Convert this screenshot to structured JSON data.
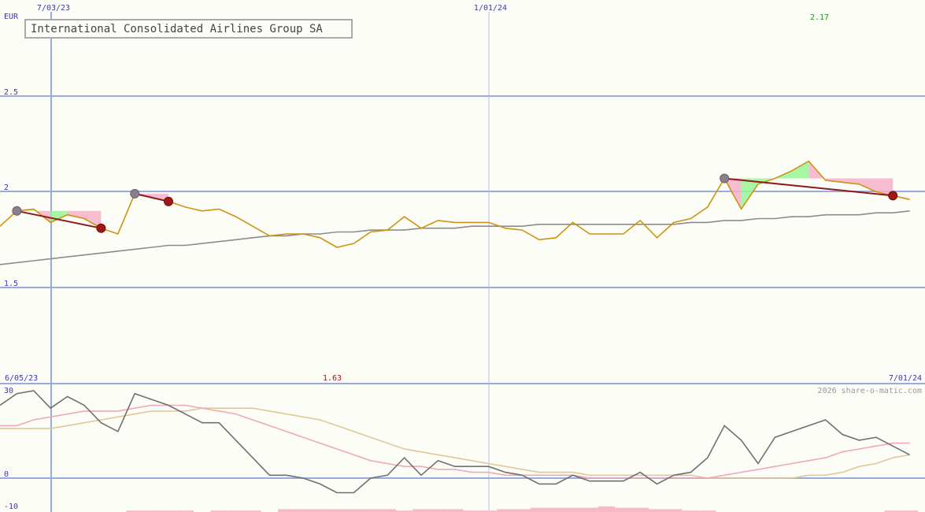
{
  "chart_data": [
    {
      "type": "line",
      "title": "International Consolidated Airlines Group SA",
      "ylabel": "EUR",
      "ylim": [
        1.5,
        2.5
      ],
      "y_ticks": [
        {
          "value": 2.5,
          "label": "2.5"
        },
        {
          "value": 2.0,
          "label": "2"
        },
        {
          "value": 1.5,
          "label": "1.5"
        }
      ],
      "x_ticks": [
        {
          "i": 3,
          "label": "7/03/23"
        },
        {
          "i": 29,
          "label": "1/01/24"
        }
      ],
      "start_date_label": "6/05/23",
      "end_date_label": "7/01/24",
      "high_label": "2.17",
      "low_label": "1.63",
      "grid": true,
      "colors": {
        "price": "#cc9411",
        "ma": "#8c8c8c",
        "trend": "#8b1a1a",
        "grid": "#99aadd",
        "up_fill": "#98f598",
        "down_fill": "#f5b0c8"
      },
      "series": [
        {
          "key": "price",
          "values": [
            1.82,
            1.9,
            1.91,
            1.84,
            1.88,
            1.86,
            1.81,
            1.78,
            1.99,
            1.97,
            1.95,
            1.92,
            1.9,
            1.91,
            1.87,
            1.82,
            1.77,
            1.78,
            1.78,
            1.76,
            1.71,
            1.73,
            1.79,
            1.8,
            1.87,
            1.81,
            1.85,
            1.84,
            1.84,
            1.84,
            1.81,
            1.8,
            1.75,
            1.76,
            1.84,
            1.78,
            1.78,
            1.78,
            1.85,
            1.76,
            1.84,
            1.86,
            1.92,
            2.07,
            1.91,
            2.04,
            2.07,
            2.11,
            2.16,
            2.06,
            2.05,
            2.04,
            2.0,
            1.98,
            1.96
          ]
        },
        {
          "key": "ma",
          "values": [
            1.62,
            1.63,
            1.64,
            1.65,
            1.66,
            1.67,
            1.68,
            1.69,
            1.7,
            1.71,
            1.72,
            1.72,
            1.73,
            1.74,
            1.75,
            1.76,
            1.77,
            1.77,
            1.78,
            1.78,
            1.79,
            1.79,
            1.8,
            1.8,
            1.8,
            1.81,
            1.81,
            1.81,
            1.82,
            1.82,
            1.82,
            1.82,
            1.83,
            1.83,
            1.83,
            1.83,
            1.83,
            1.83,
            1.83,
            1.83,
            1.83,
            1.84,
            1.84,
            1.85,
            1.85,
            1.86,
            1.86,
            1.87,
            1.87,
            1.88,
            1.88,
            1.88,
            1.89,
            1.89,
            1.9
          ]
        }
      ],
      "trend_segments": [
        {
          "i1": 1,
          "i2": 6
        },
        {
          "i1": 8,
          "i2": 10
        },
        {
          "i1": 43,
          "i2": 53
        }
      ]
    },
    {
      "type": "line",
      "ylim": [
        -10,
        30
      ],
      "y_ticks": [
        {
          "value": 30,
          "label": "30"
        },
        {
          "value": 0,
          "label": "0"
        },
        {
          "value": -10,
          "label": "-10"
        }
      ],
      "watermark": "2026 share-o-matic.com",
      "grid": true,
      "colors": {
        "line1": "#707070",
        "line2": "#f0a8b8",
        "line3": "#e0c898",
        "bars": "#f8b8c8"
      },
      "series": [
        {
          "key": "line1",
          "values": [
            25,
            29,
            30,
            24,
            28,
            25,
            19,
            16,
            29,
            27,
            25,
            22,
            19,
            19,
            13,
            7,
            1,
            1,
            0,
            -2,
            -5,
            -5,
            0,
            1,
            7,
            1,
            6,
            4,
            4,
            4,
            2,
            1,
            -2,
            -2,
            1,
            -1,
            -1,
            -1,
            2,
            -2,
            1,
            2,
            7,
            18,
            13,
            5,
            14,
            16,
            18,
            20,
            15,
            13,
            14,
            11,
            8
          ]
        },
        {
          "key": "line2",
          "values": [
            18,
            18,
            20,
            21,
            22,
            23,
            23,
            23,
            24,
            25,
            25,
            25,
            24,
            23,
            22,
            20,
            18,
            16,
            14,
            12,
            10,
            8,
            6,
            5,
            4,
            4,
            3,
            3,
            2,
            2,
            1,
            1,
            1,
            1,
            1,
            0,
            0,
            0,
            0,
            0,
            0,
            0,
            0,
            1,
            2,
            3,
            4,
            5,
            6,
            7,
            9,
            10,
            11,
            12,
            12
          ]
        },
        {
          "key": "line3",
          "values": [
            17,
            17,
            17,
            17,
            18,
            19,
            20,
            21,
            22,
            23,
            23,
            23,
            24,
            24,
            24,
            24,
            23,
            22,
            21,
            20,
            18,
            16,
            14,
            12,
            10,
            9,
            8,
            7,
            6,
            5,
            4,
            3,
            2,
            2,
            2,
            1,
            1,
            1,
            1,
            1,
            1,
            1,
            0,
            0,
            0,
            0,
            0,
            0,
            1,
            1,
            2,
            4,
            5,
            7,
            8
          ]
        }
      ],
      "bars": [
        0,
        0,
        0,
        0,
        0,
        0,
        0,
        0,
        1,
        1,
        1,
        1,
        0,
        1,
        1,
        1,
        0,
        2,
        2,
        2,
        2,
        2,
        2,
        2,
        1,
        2,
        2,
        2,
        1,
        1,
        2,
        2,
        3,
        3,
        3,
        3,
        4,
        3,
        3,
        2,
        2,
        1,
        1,
        0,
        0,
        0,
        0,
        0,
        0,
        0,
        0,
        0,
        0,
        1,
        1
      ]
    }
  ]
}
